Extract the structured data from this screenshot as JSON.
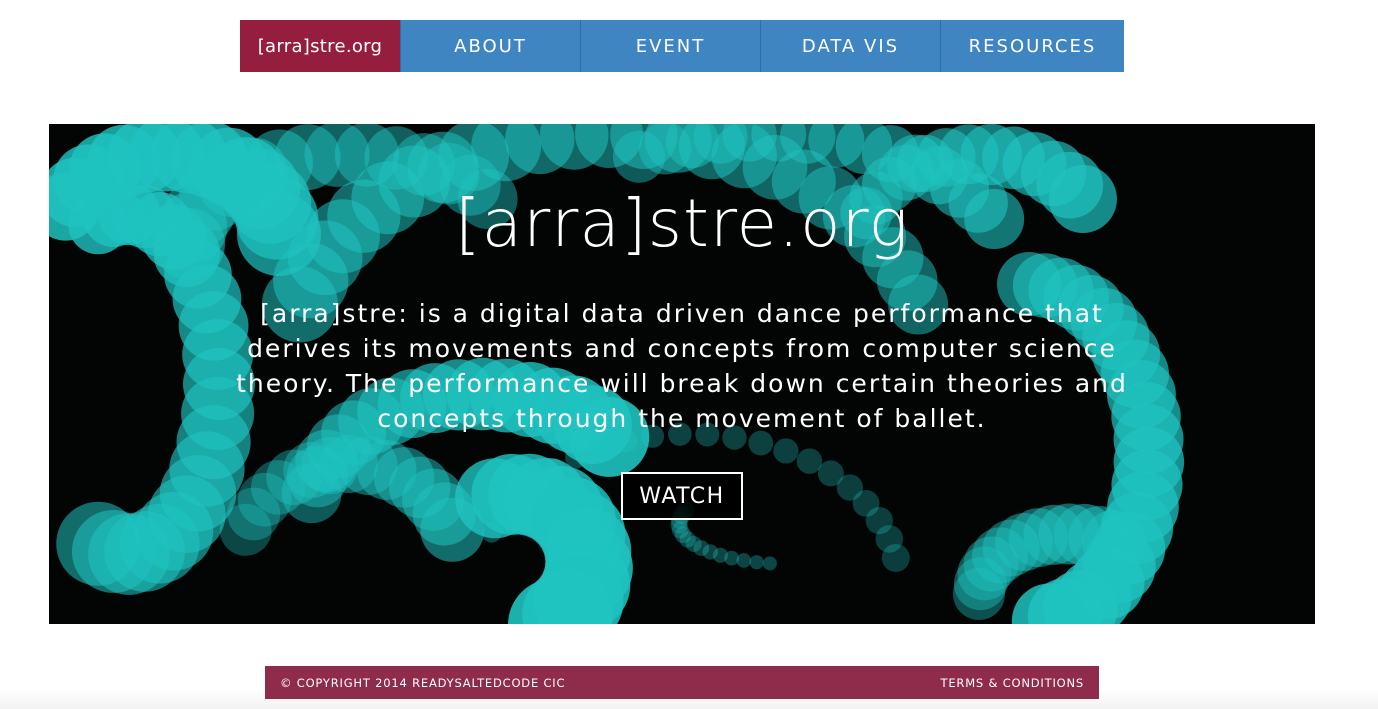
{
  "nav": {
    "logo": "[arra]stre.org",
    "items": [
      {
        "label": "ABOUT"
      },
      {
        "label": "EVENT"
      },
      {
        "label": "DATA VIS"
      },
      {
        "label": "RESOURCES"
      }
    ]
  },
  "hero": {
    "logo": "[arra]stre.org",
    "description": "[arra]stre: is a digital data driven dance performance that derives its movements and concepts from computer science theory. The performance will break down certain theories and concepts through the movement of ballet.",
    "button_label": "WATCH"
  },
  "footer": {
    "copyright": "© COPYRIGHT 2014 READYSALTEDCODE CIC",
    "terms": "TERMS & CONDITIONS"
  },
  "colors": {
    "nav_logo_bg": "#951e3e",
    "nav_bg": "#3f85c1",
    "hero_bg": "#030404",
    "circles": "#1fc3c0",
    "footer_bg": "#8f2c4b"
  }
}
